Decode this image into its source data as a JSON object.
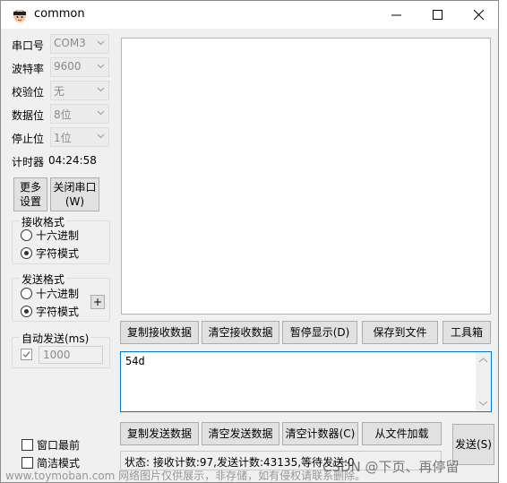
{
  "window": {
    "title": "common"
  },
  "serial": {
    "port_label": "串口号",
    "port_value": "COM3",
    "baud_label": "波特率",
    "baud_value": "9600",
    "parity_label": "校验位",
    "parity_value": "无",
    "databits_label": "数据位",
    "databits_value": "8位",
    "stopbits_label": "停止位",
    "stopbits_value": "1位"
  },
  "timer": {
    "label": "计时器",
    "value": "04:24:58"
  },
  "buttons": {
    "more_settings": "更多\n设置",
    "close_port": "关闭串口\n(W)",
    "copy_rx": "复制接收数据",
    "clear_rx": "清空接收数据",
    "pause_display": "暂停显示(D)",
    "save_to_file": "保存到文件",
    "toolbox": "工具箱",
    "copy_tx": "复制发送数据",
    "clear_tx": "清空发送数据",
    "clear_counter": "清空计数器(C)",
    "load_from_file": "从文件加载",
    "send": "发送(S)",
    "plus": "+"
  },
  "receive_format": {
    "title": "接收格式",
    "option_hex": "十六进制",
    "option_char": "字符模式",
    "selected": "字符模式"
  },
  "send_format": {
    "title": "发送格式",
    "option_hex": "十六进制",
    "option_char": "字符模式",
    "selected": "字符模式"
  },
  "auto_send": {
    "title": "自动发送(ms)",
    "checked": true,
    "interval": "1000"
  },
  "options": {
    "stay_on_top": "窗口最前",
    "simple_mode": "简洁模式"
  },
  "send_input": {
    "value": "54d"
  },
  "status_bar": {
    "text": "状态: 接收计数:97,发送计数:43135,等待发送:0"
  },
  "watermarks": {
    "bottom_left": "www.toymoban.com 网络图片仅供展示，非存储，如有侵权请联系删除。",
    "bottom_right": "CSDN @下页、再停留"
  },
  "colors": {
    "accent": "#0078d7",
    "window_bg": "#f0f0f0",
    "button_bg": "#e1e1e1"
  }
}
